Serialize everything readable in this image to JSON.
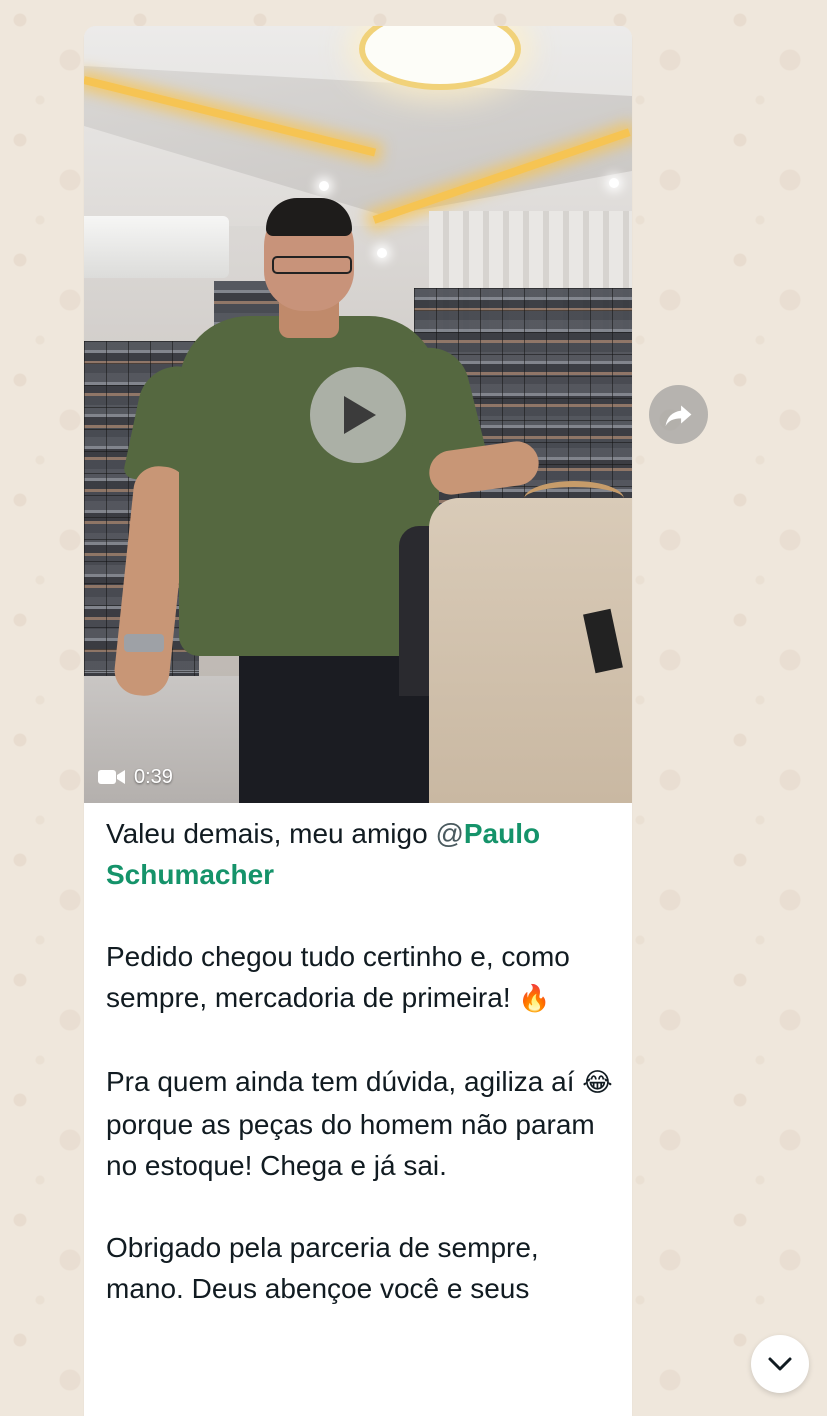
{
  "message": {
    "video": {
      "duration": "0:39"
    },
    "caption": {
      "line1_text": "Valeu demais, meu amigo ",
      "mention_at": "@",
      "mention_name": "Paulo Schumacher",
      "para2": "Pedido chegou tudo certinho e, como sempre, mercadoria de primeira! ",
      "para2_emoji": "🔥",
      "para3_part1": "Pra quem ainda tem dúvida, agiliza aí ",
      "para3_emoji": "😂",
      "para3_part2": " porque as peças do homem não param no estoque! Chega e já sai.",
      "para4": "Obrigado pela parceria de sempre, mano. Deus abençoe você e seus"
    }
  },
  "icons": {
    "play": "play-icon",
    "video_camera": "video-camera-icon",
    "forward": "forward-icon",
    "scroll_down": "chevron-down-icon"
  },
  "colors": {
    "mention": "#15936a",
    "text": "#111b21",
    "wallpaper": "#efe7dc"
  }
}
